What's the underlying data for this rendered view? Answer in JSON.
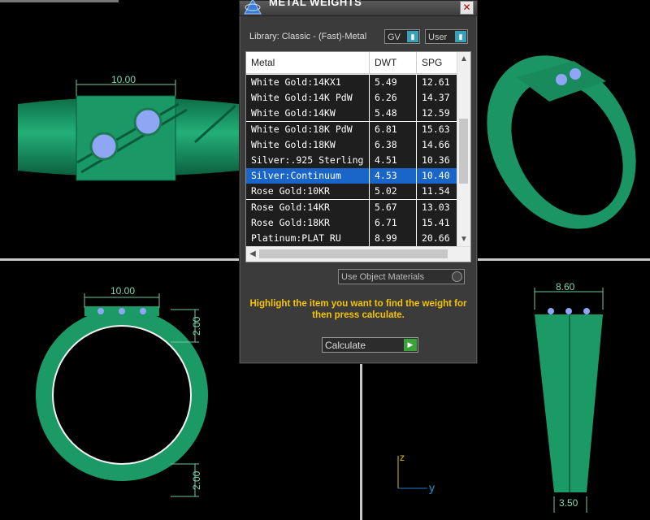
{
  "dialog": {
    "title": "METAL WEIGHTS",
    "close_label": "✕",
    "library_label": "Library: Classic - (Fast)-Metal",
    "gv_label": "GV",
    "user_label": "User",
    "columns": [
      "Metal",
      "DWT",
      "SPG"
    ],
    "rows": [
      {
        "metal": "White Gold:14KX1",
        "dwt": "5.49",
        "spg": "12.61"
      },
      {
        "metal": "White Gold:14K PdW",
        "dwt": "6.26",
        "spg": "14.37"
      },
      {
        "metal": "White Gold:14KW",
        "dwt": "5.48",
        "spg": "12.59"
      },
      {
        "metal": "White Gold:18K PdW",
        "dwt": "6.81",
        "spg": "15.63"
      },
      {
        "metal": "White Gold:18KW",
        "dwt": "6.38",
        "spg": "14.66"
      },
      {
        "metal": "Silver:.925 Sterling",
        "dwt": "4.51",
        "spg": "10.36"
      },
      {
        "metal": "Silver:Continuum",
        "dwt": "4.53",
        "spg": "10.40"
      },
      {
        "metal": "Rose Gold:10KR",
        "dwt": "5.02",
        "spg": "11.54"
      },
      {
        "metal": "Rose Gold:14KR",
        "dwt": "5.67",
        "spg": "13.03"
      },
      {
        "metal": "Rose Gold:18KR",
        "dwt": "6.71",
        "spg": "15.41"
      },
      {
        "metal": "Platinum:PLAT RU",
        "dwt": "8.99",
        "spg": "20.66"
      }
    ],
    "selected_row": 6,
    "use_object_materials": "Use Object Materials",
    "hint": "Highlight the item you want to find the weight for then press calculate.",
    "calculate_label": "Calculate"
  },
  "viewports": {
    "top_left_dim": "10.00",
    "bottom_left_dim_top": "10.00",
    "bottom_left_dim_side1": "2.00",
    "bottom_left_dim_side2": "2.00",
    "bottom_right_dim_top": "8.60",
    "bottom_right_dim_bottom": "3.50",
    "axis_z": "z",
    "axis_y": "y"
  },
  "colors": {
    "ring_green": "#1f9a66",
    "ring_dark": "#0e6a45",
    "selection_blue": "#1a66c8",
    "hint_yellow": "#f5c400"
  }
}
